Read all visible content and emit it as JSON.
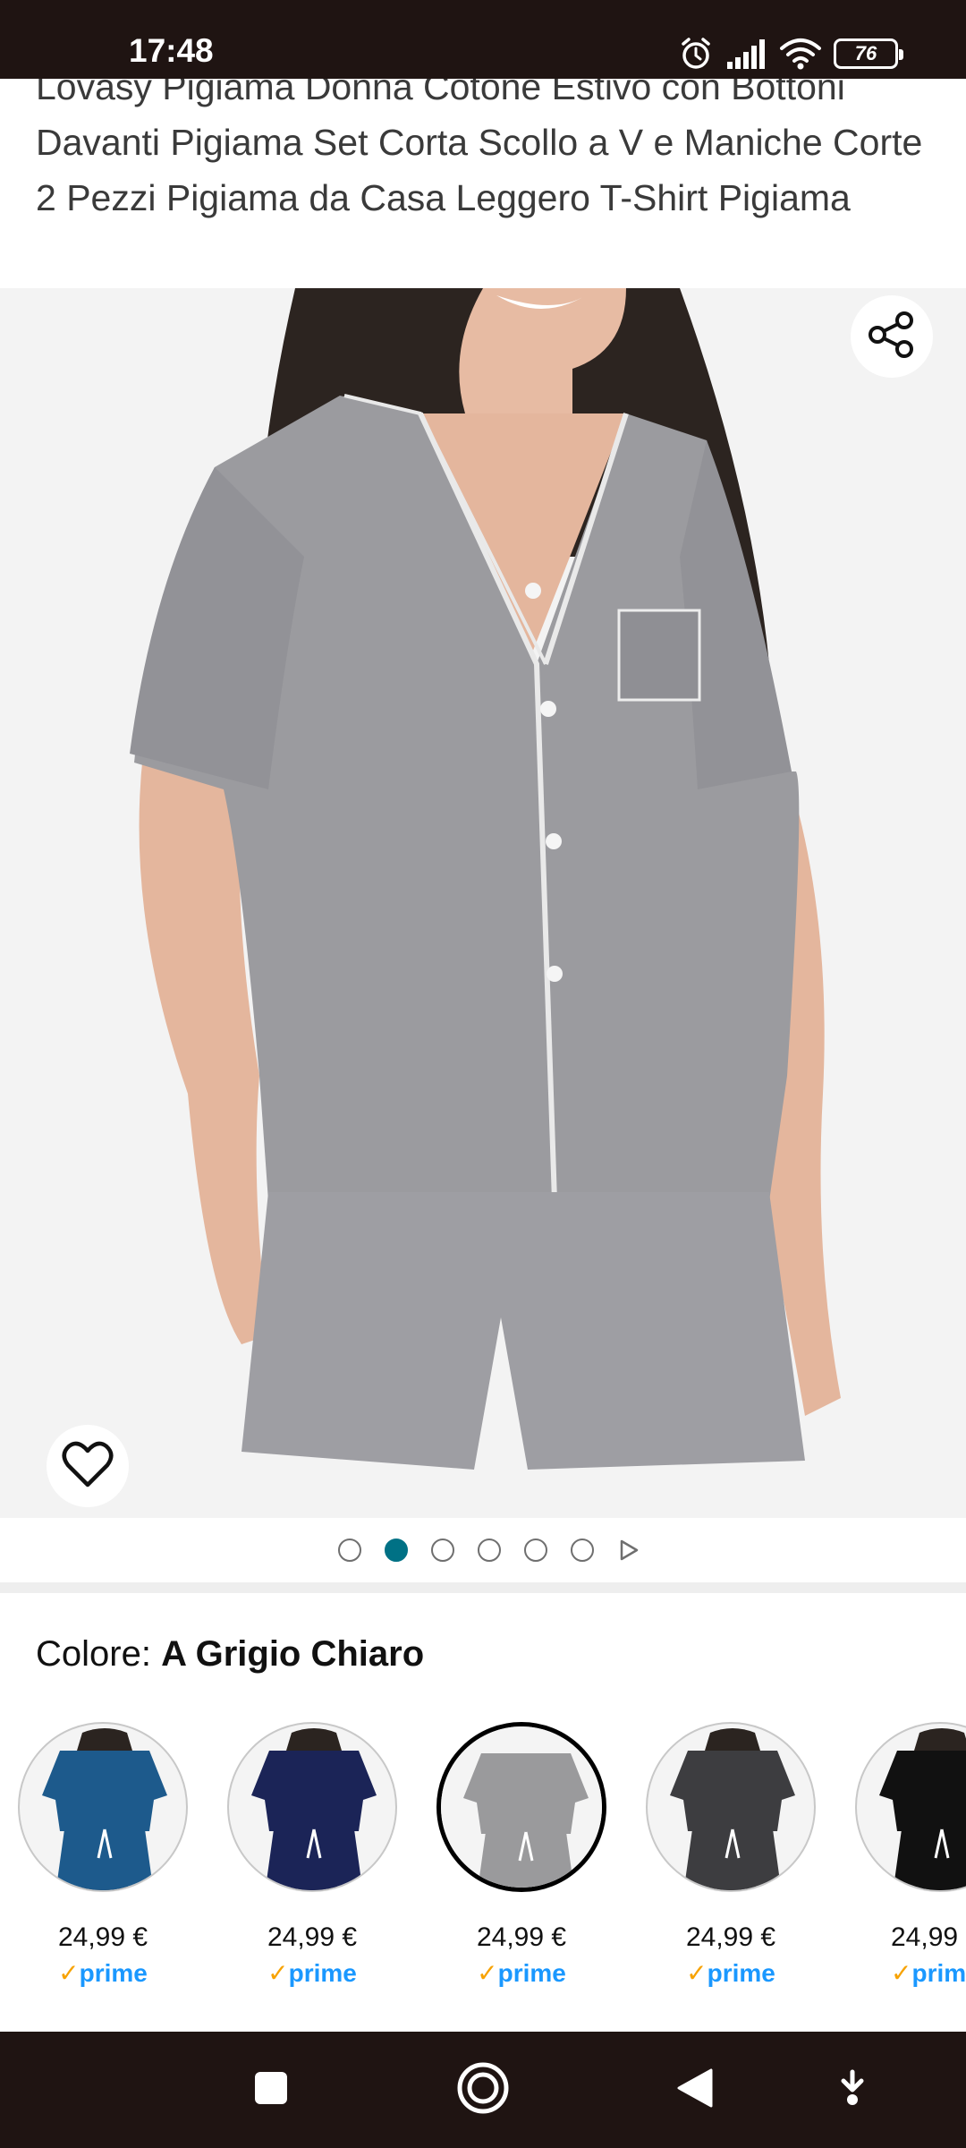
{
  "status_bar": {
    "time": "17:48",
    "battery": "76",
    "icons": [
      "alarm-icon",
      "signal-icon",
      "wifi-icon",
      "battery-icon"
    ]
  },
  "product": {
    "title": "Lovasy Pigiama Donna Cotone Estivo con Bottoni Davanti Pigiama Set Corta Scollo a V e Maniche Corte 2 Pezzi Pigiama da Casa Leggero T-Shirt Pigiama"
  },
  "image": {
    "share_icon": "share-icon",
    "wishlist_icon": "heart-icon",
    "dot_count": 6,
    "active_dot": 2
  },
  "color": {
    "label": "Colore:",
    "selected_value": "A Grigio Chiaro"
  },
  "swatches": [
    {
      "price": "24,99 €",
      "prime": "prime",
      "color": "#1d5a8c",
      "selected": false
    },
    {
      "price": "24,99 €",
      "prime": "prime",
      "color": "#1b2457",
      "selected": false
    },
    {
      "price": "24,99 €",
      "prime": "prime",
      "color": "#9a9a9c",
      "selected": true
    },
    {
      "price": "24,99 €",
      "prime": "prime",
      "color": "#3d3d40",
      "selected": false
    },
    {
      "price": "24,99",
      "prime": "prim",
      "color": "#111111",
      "selected": false
    }
  ],
  "colors": {
    "accent_teal": "#007185",
    "prime_blue": "#1a98ff",
    "prime_check": "#f7a200",
    "system_bar": "#1f1412"
  },
  "nav_bar": {
    "icons": [
      "recents-square-icon",
      "home-circle-icon",
      "back-triangle-icon",
      "download-arrow-icon"
    ]
  }
}
